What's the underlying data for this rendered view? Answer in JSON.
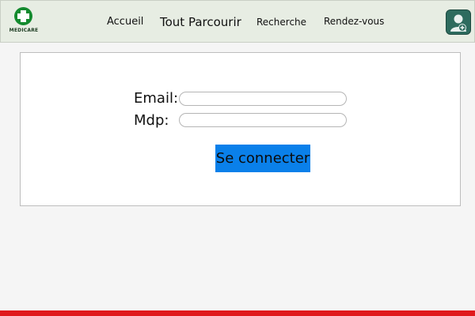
{
  "brand": {
    "name": "MEDICARE",
    "color": "#138a2e"
  },
  "nav": {
    "items": [
      {
        "label": "Accueil"
      },
      {
        "label": "Tout Parcourir"
      },
      {
        "label": "Recherche"
      },
      {
        "label": "Rendez-vous"
      }
    ],
    "user_icon": "user-plus-icon"
  },
  "login": {
    "email_label": "Email:",
    "email_value": "",
    "password_label": "Mdp:",
    "password_value": "",
    "submit_label": "Se connecter",
    "submit_color": "#0a80ea"
  },
  "theme": {
    "nav_bg": "#e7ede3",
    "accent_red": "#e0191c"
  }
}
